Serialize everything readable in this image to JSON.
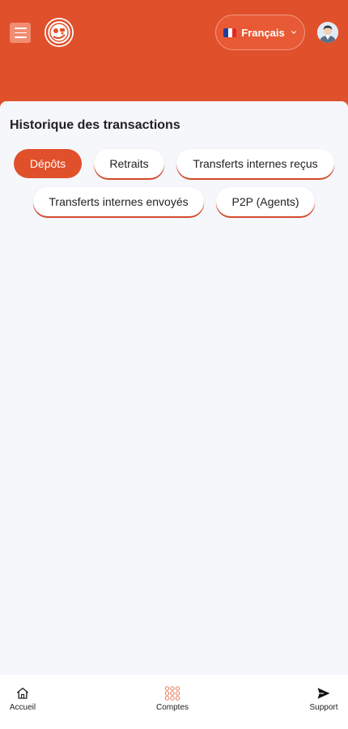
{
  "header": {
    "language": {
      "flag": "flag-fr-icon",
      "label": "Français"
    },
    "colors": {
      "primary": "#e0502b",
      "menu_button": "#f08d72"
    }
  },
  "page": {
    "title": "Historique des transactions",
    "tabs": [
      {
        "label": "Dépôts",
        "active": true
      },
      {
        "label": "Retraits",
        "active": false
      },
      {
        "label": "Transferts internes reçus",
        "active": false
      },
      {
        "label": "Transferts internes envoyés",
        "active": false
      },
      {
        "label": "P2P (Agents)",
        "active": false
      }
    ]
  },
  "bottom_nav": {
    "items": [
      {
        "label": "Accueil",
        "icon": "home-icon"
      },
      {
        "label": "Comptes",
        "icon": "grid-icon"
      },
      {
        "label": "Support",
        "icon": "send-icon"
      }
    ]
  }
}
